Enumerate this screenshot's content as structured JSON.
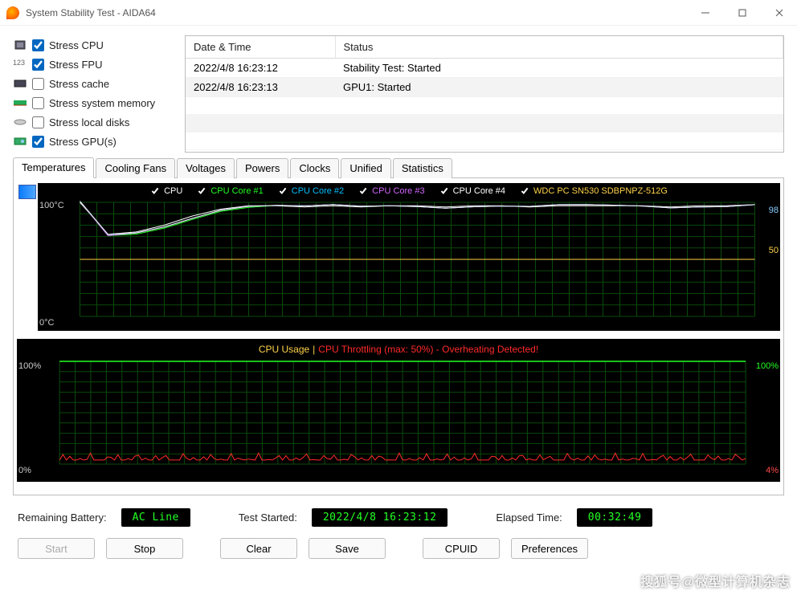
{
  "window": {
    "title": "System Stability Test - AIDA64"
  },
  "stress": [
    {
      "label": "Stress CPU",
      "checked": true
    },
    {
      "label": "Stress FPU",
      "checked": true
    },
    {
      "label": "Stress cache",
      "checked": false
    },
    {
      "label": "Stress system memory",
      "checked": false
    },
    {
      "label": "Stress local disks",
      "checked": false
    },
    {
      "label": "Stress GPU(s)",
      "checked": true
    }
  ],
  "log": {
    "headers": {
      "datetime": "Date & Time",
      "status": "Status"
    },
    "rows": [
      {
        "datetime": "2022/4/8 16:23:12",
        "status": "Stability Test: Started"
      },
      {
        "datetime": "2022/4/8 16:23:13",
        "status": "GPU1: Started"
      }
    ]
  },
  "tabs": [
    "Temperatures",
    "Cooling Fans",
    "Voltages",
    "Powers",
    "Clocks",
    "Unified",
    "Statistics"
  ],
  "active_tab": 0,
  "temp_chart": {
    "legend": [
      {
        "label": "CPU",
        "color": "#ffffff"
      },
      {
        "label": "CPU Core #1",
        "color": "#21ff21"
      },
      {
        "label": "CPU Core #2",
        "color": "#00bfff"
      },
      {
        "label": "CPU Core #3",
        "color": "#d266ff"
      },
      {
        "label": "CPU Core #4",
        "color": "#ffffff"
      },
      {
        "label": "WDC PC SN530 SDBPNPZ-512G",
        "color": "#ffd24a"
      }
    ],
    "ymax_label": "100°C",
    "ymin_label": "0°C",
    "right_top": "98",
    "right_mid": "50"
  },
  "usage_chart": {
    "title_left": "CPU Usage",
    "title_right": "CPU Throttling (max: 50%) - Overheating Detected!",
    "ymax": "100%",
    "ymin": "0%",
    "right_top": "100%",
    "right_bot": "4%"
  },
  "status": {
    "battery_label": "Remaining Battery:",
    "battery_value": "AC Line",
    "started_label": "Test Started:",
    "started_value": "2022/4/8 16:23:12",
    "elapsed_label": "Elapsed Time:",
    "elapsed_value": "00:32:49"
  },
  "buttons": {
    "start": "Start",
    "stop": "Stop",
    "clear": "Clear",
    "save": "Save",
    "cpuid": "CPUID",
    "prefs": "Preferences"
  },
  "watermark": "搜狐号@微型计算机杂志",
  "chart_data": [
    {
      "type": "line",
      "title": "Temperatures",
      "ylabel": "°C",
      "ylim": [
        0,
        100
      ],
      "x": "time (relative, 0–1 of window)",
      "series": [
        {
          "name": "CPU",
          "approx_values": [
            100,
            72,
            74,
            80,
            88,
            94,
            97,
            97,
            96,
            97,
            96,
            97,
            97,
            96,
            97,
            97,
            96,
            97,
            97,
            97,
            97,
            96,
            97,
            97,
            98
          ]
        },
        {
          "name": "CPU Core #1",
          "approx_values": [
            100,
            70,
            72,
            78,
            86,
            93,
            96,
            97,
            96,
            97,
            96,
            97,
            97,
            96,
            97,
            97,
            96,
            97,
            97,
            97,
            97,
            96,
            97,
            97,
            98
          ]
        },
        {
          "name": "CPU Core #2",
          "approx_values": [
            100,
            71,
            73,
            79,
            87,
            94,
            97,
            97,
            96,
            97,
            96,
            97,
            97,
            96,
            97,
            97,
            96,
            97,
            97,
            97,
            97,
            96,
            97,
            97,
            98
          ]
        },
        {
          "name": "CPU Core #3",
          "approx_values": [
            100,
            70,
            73,
            79,
            87,
            94,
            97,
            97,
            96,
            97,
            96,
            97,
            97,
            96,
            97,
            97,
            96,
            97,
            97,
            97,
            97,
            96,
            97,
            97,
            98
          ]
        },
        {
          "name": "CPU Core #4",
          "approx_values": [
            100,
            71,
            73,
            79,
            87,
            94,
            97,
            97,
            96,
            97,
            96,
            97,
            97,
            96,
            97,
            97,
            96,
            97,
            97,
            97,
            97,
            96,
            97,
            97,
            98
          ]
        },
        {
          "name": "WDC PC SN530 SDBPNPZ-512G",
          "approx_values": [
            50,
            50,
            50,
            50,
            50,
            50,
            50,
            50,
            50,
            50,
            50,
            50,
            50,
            50,
            50,
            50,
            50,
            50,
            50,
            50,
            50,
            50,
            50,
            50,
            50
          ]
        }
      ],
      "current_right_labels": {
        "top": 98,
        "mid": 50
      }
    },
    {
      "type": "line",
      "title": "CPU Usage / Throttling",
      "ylim": [
        0,
        100
      ],
      "ylabel": "%",
      "series": [
        {
          "name": "CPU Usage",
          "approx_values_all": 100
        },
        {
          "name": "CPU Throttling",
          "approx_values_range": [
            0,
            12
          ],
          "note": "jittery low red trace averaging ~4%"
        }
      ],
      "current_right_labels": {
        "top": "100%",
        "bottom": "4%"
      },
      "warning": "Overheating Detected!",
      "throttling_max_pct": 50
    }
  ]
}
